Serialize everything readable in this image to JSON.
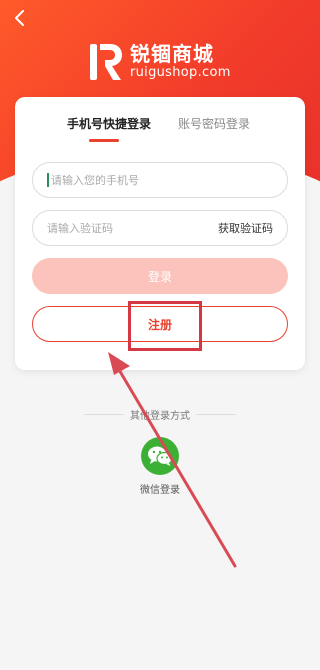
{
  "brand": {
    "name_cn": "锐锢商城",
    "domain": "ruigushop.com"
  },
  "tabs": [
    {
      "label": "手机号快捷登录",
      "active": true
    },
    {
      "label": "账号密码登录",
      "active": false
    }
  ],
  "form": {
    "phone_placeholder": "请输入您的手机号",
    "code_placeholder": "请输入验证码",
    "get_code_label": "获取验证码",
    "login_label": "登录",
    "register_label": "注册"
  },
  "other_login": {
    "title": "其他登录方式",
    "wechat_label": "微信登录"
  },
  "colors": {
    "brand_red": "#e8412e",
    "login_disabled": "#fbc3bb",
    "wechat_green": "#3cb035",
    "annotation_red": "#d53843"
  },
  "icons": {
    "back": "chevron-left-icon",
    "logo": "r-logo-icon",
    "wechat": "wechat-icon"
  }
}
